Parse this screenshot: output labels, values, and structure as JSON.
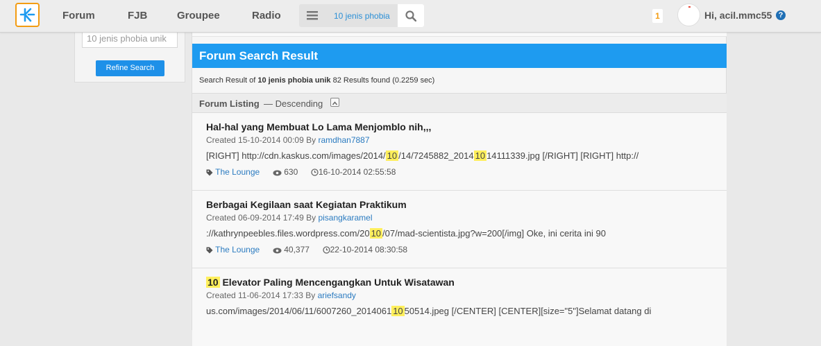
{
  "nav": {
    "links": [
      "Forum",
      "FJB",
      "Groupee",
      "Radio"
    ],
    "search_value": "10 jenis phobia",
    "notif_count": "1",
    "greeting": "Hi, acil.mmc55",
    "help": "?"
  },
  "sidebar": {
    "search_value": "10 jenis phobia unik",
    "refine_label": "Refine Search"
  },
  "main": {
    "title": "Forum Search Result",
    "summary_prefix": "Search Result of",
    "summary_query": "10 jenis phobia unik",
    "summary_suffix": "82 Results found (0.2259 sec)",
    "listing_label": "Forum Listing",
    "listing_order": "— Descending"
  },
  "threads": [
    {
      "title_parts": [
        "",
        "Hal-hal yang Membuat Lo Lama Menjomblo nih,,,"
      ],
      "created": "Created 15-10-2014 00:09 By",
      "author": "ramdhan7887",
      "snippet_parts": [
        "[RIGHT] http://cdn.kaskus.com/images/2014/",
        "10",
        "/14/7245882_2014",
        "10",
        "14111339.jpg [/RIGHT] [RIGHT] http://"
      ],
      "forum": "The Lounge",
      "views": "630",
      "last": "16-10-2014 02:55:58"
    },
    {
      "title_parts": [
        "",
        "Berbagai Kegilaan saat Kegiatan Praktikum"
      ],
      "created": "Created 06-09-2014 17:49 By",
      "author": "pisangkaramel",
      "snippet_parts": [
        "://kathrynpeebles.files.wordpress.com/20",
        "10",
        "/07/mad-scientista.jpg?w=200[/img] Oke, ini cerita ini 90"
      ],
      "forum": "The Lounge",
      "views": "40,377",
      "last": "22-10-2014 08:30:58"
    },
    {
      "title_parts": [
        "10",
        " Elevator Paling Mencengangkan Untuk Wisatawan"
      ],
      "created": "Created 11-06-2014 17:33 By",
      "author": "ariefsandy",
      "snippet_parts": [
        "us.com/images/2014/06/11/6007260_2014061",
        "10",
        "50514.jpeg [/CENTER] [CENTER][size=\"5\"]Selamat datang di"
      ],
      "forum": "",
      "views": "",
      "last": ""
    }
  ]
}
